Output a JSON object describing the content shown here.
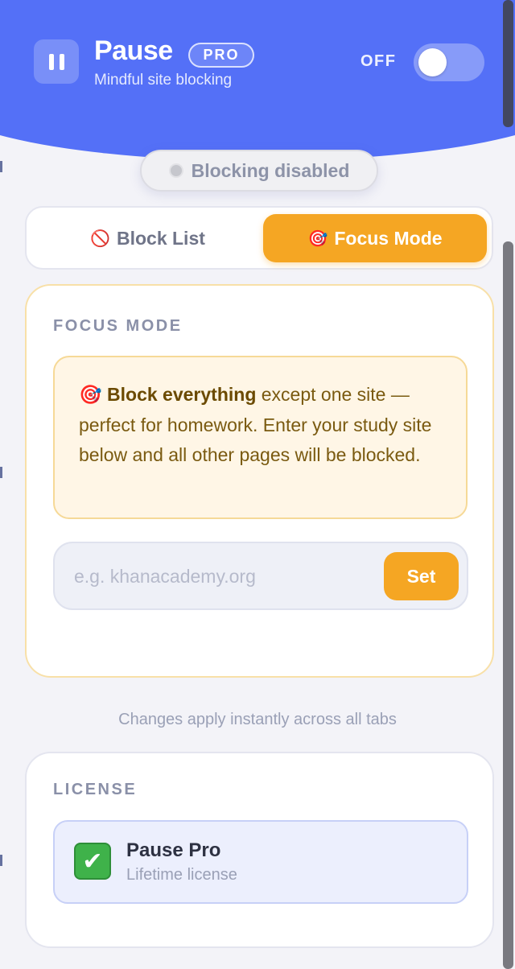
{
  "header": {
    "title": "Pause",
    "badge": "PRO",
    "subtitle": "Mindful site blocking",
    "toggle_label": "OFF",
    "toggle_on": false,
    "icon": "pause-icon",
    "background_color": "#5470f7"
  },
  "status": {
    "text": "Blocking disabled",
    "icon": "status-dot-icon"
  },
  "tabs": [
    {
      "label": "Block List",
      "icon": "🚫",
      "active": false
    },
    {
      "label": "Focus Mode",
      "icon": "🎯",
      "active": true
    }
  ],
  "focus": {
    "section_label": "FOCUS MODE",
    "info_icon": "🎯",
    "info_strong": "Block everything",
    "info_rest": " except one site — perfect for homework. Enter your study site below and all other pages will be blocked.",
    "input_value": "",
    "input_placeholder": "e.g. khanacademy.org",
    "set_label": "Set"
  },
  "note": "Changes apply instantly across all tabs",
  "license": {
    "section_label": "LICENSE",
    "icon": "✔",
    "name": "Pause Pro",
    "type": "Lifetime license"
  },
  "colors": {
    "accent": "#5470f7",
    "focus": "#f5a623",
    "success": "#3fb24a"
  }
}
